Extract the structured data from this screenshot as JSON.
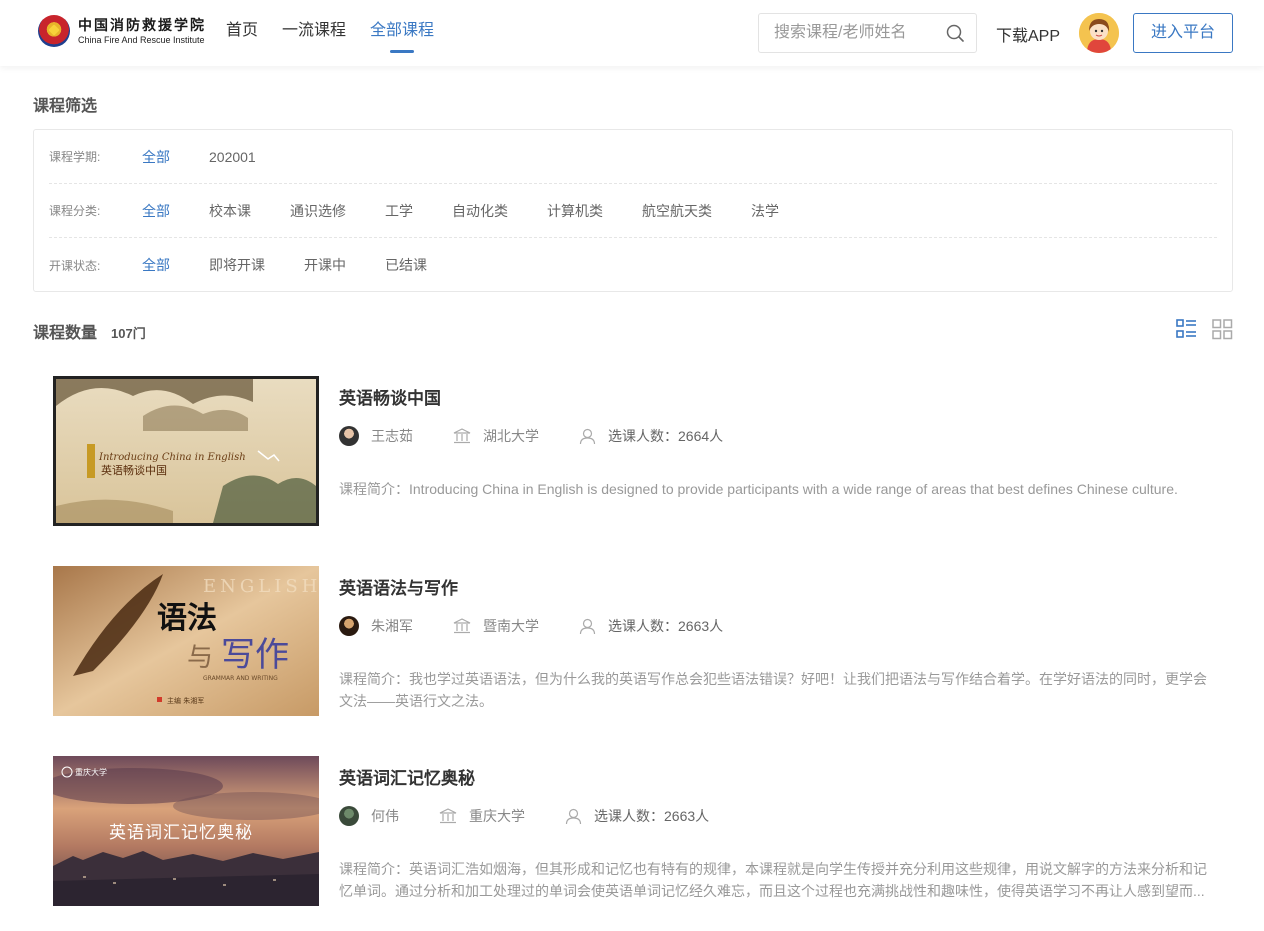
{
  "header": {
    "logo_cn": "中国消防救援学院",
    "logo_en": "China Fire And Rescue Institute",
    "nav": [
      {
        "label": "首页",
        "active": false
      },
      {
        "label": "一流课程",
        "active": false
      },
      {
        "label": "全部课程",
        "active": true
      }
    ],
    "search_placeholder": "搜索课程/老师姓名",
    "download_label": "下载APP",
    "platform_label": "进入平台"
  },
  "filters": {
    "title": "课程筛选",
    "rows": [
      {
        "label": "课程学期:",
        "options": [
          "全部",
          "202001"
        ]
      },
      {
        "label": "课程分类:",
        "options": [
          "全部",
          "校本课",
          "通识选修",
          "工学",
          "自动化类",
          "计算机类",
          "航空航天类",
          "法学"
        ]
      },
      {
        "label": "开课状态:",
        "options": [
          "全部",
          "即将开课",
          "开课中",
          "已结课"
        ]
      }
    ]
  },
  "count": {
    "label": "课程数量",
    "value": "107门"
  },
  "courses": [
    {
      "title": "英语畅谈中国",
      "teacher": "王志茹",
      "school": "湖北大学",
      "enroll": "选课人数：2664人",
      "desc": "课程简介：Introducing China in English is designed to provide participants with a wide range of areas that best defines Chinese culture.",
      "thumb_text_en": "Introducing China in English",
      "thumb_text_cn": "英语畅谈中国"
    },
    {
      "title": "英语语法与写作",
      "teacher": "朱湘军",
      "school": "暨南大学",
      "enroll": "选课人数：2663人",
      "desc": "课程简介：我也学过英语语法，但为什么我的英语写作总会犯些语法错误？好吧！让我们把语法与写作结合着学。在学好语法的同时，更学会文法——英语行文之法。",
      "thumb_text_en": "ENGLISH",
      "thumb_text_cn1": "语法",
      "thumb_text_cn2": "与",
      "thumb_text_cn3": "写作",
      "thumb_sub": "GRAMMAR AND WRITING",
      "thumb_author": "主编  朱湘军"
    },
    {
      "title": "英语词汇记忆奥秘",
      "teacher": "何伟",
      "school": "重庆大学",
      "enroll": "选课人数：2663人",
      "desc": "课程简介：英语词汇浩如烟海，但其形成和记忆也有特有的规律，本课程就是向学生传授并充分利用这些规律，用说文解字的方法来分析和记忆单词。通过分析和加工处理过的单词会使英语单词记忆经久难忘，而且这个过程也充满挑战性和趣味性，使得英语学习不再让人感到望而...",
      "thumb_text_cn": "英语词汇记忆奥秘",
      "thumb_badge": "重庆大学"
    }
  ],
  "colors": {
    "accent": "#3a78c3",
    "text": "#333333",
    "muted": "#999999"
  }
}
